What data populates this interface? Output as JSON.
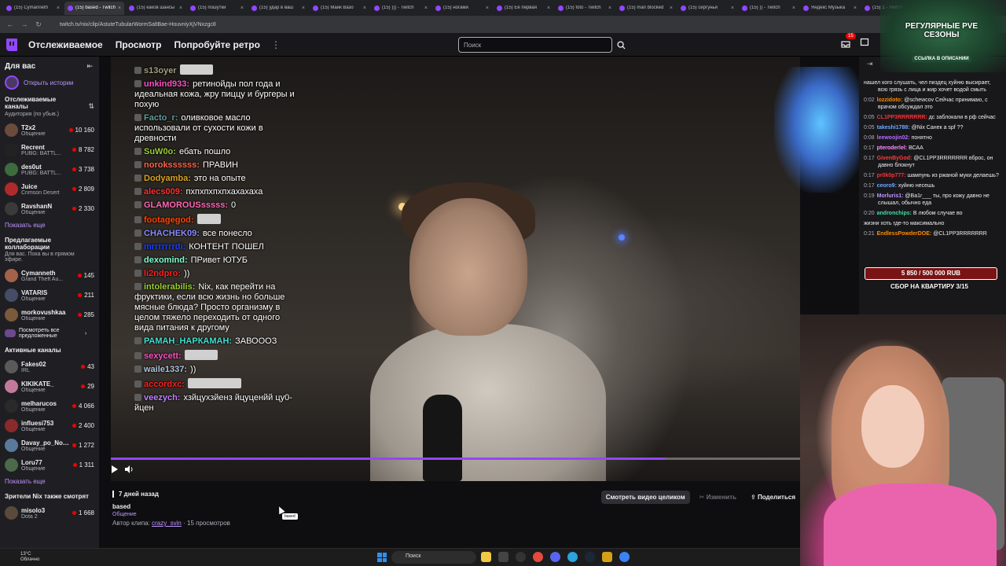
{
  "browser": {
    "tabs": [
      {
        "label": "(15) Cymanneth",
        "active": false
      },
      {
        "label": "(15) based - Twitch",
        "active": true
      },
      {
        "label": "(15) каков шансы",
        "active": false
      },
      {
        "label": "(15) пошутки",
        "active": false
      },
      {
        "label": "(15) удар в ваш",
        "active": false
      },
      {
        "label": "(15) Майк Вазо",
        "active": false
      },
      {
        "label": "(15) ))) - Twitch",
        "active": false
      },
      {
        "label": "(15) ногами",
        "active": false
      },
      {
        "label": "(15) Её первая",
        "active": false
      },
      {
        "label": "(15) foto - Twitch",
        "active": false
      },
      {
        "label": "(15) man blocked",
        "active": false
      },
      {
        "label": "(15) сергунья",
        "active": false
      },
      {
        "label": "(15) )) - Twitch",
        "active": false
      },
      {
        "label": "Яндекс Музыка",
        "active": false
      },
      {
        "label": "(15) 1 - Twitch",
        "active": false
      }
    ],
    "url": "twitch.tv/nix/clip/AstuteTubularWormSaltBae-HouvniyXjVNxzgc8"
  },
  "nav": {
    "following": "Отслеживаемое",
    "browse": "Просмотр",
    "retro": "Попробуйте ретро",
    "more": "⋮",
    "search_placeholder": "Поиск",
    "notif_count": "15"
  },
  "sidebar": {
    "for_you": "Для вас",
    "open_stories": "Открыть истории",
    "followed_title": "Отслеживаемые каналы",
    "followed_sub": "Аудитория (по убыв.)",
    "followed": [
      {
        "name": "T2x2",
        "category": "Общение",
        "viewers": "10 160",
        "color": "#6b4b3b"
      },
      {
        "name": "Recrent",
        "category": "PUBG: BATTL...",
        "viewers": "8 782",
        "color": "#222222"
      },
      {
        "name": "des0ut",
        "category": "PUBG: BATTL...",
        "viewers": "3 738",
        "color": "#3d6b3d"
      },
      {
        "name": "Juice",
        "category": "Crimson Desert",
        "viewers": "2 809",
        "color": "#b02a2a"
      },
      {
        "name": "RavshanN",
        "category": "Общение",
        "viewers": "2 330",
        "color": "#3a3a3a"
      }
    ],
    "show_more_1": "Показать еще",
    "recommended_title": "Предлагаемые коллаборации",
    "recommended_sub": "Для вас. Пока вы в прямом эфире.",
    "recommended": [
      {
        "name": "Cymanneth",
        "category": "Grand Theft Au...",
        "viewers": "145",
        "color": "#a3624a"
      },
      {
        "name": "VATARIS",
        "category": "Общение",
        "viewers": "211",
        "color": "#444c66"
      },
      {
        "name": "morkovushkaa",
        "category": "Общение",
        "viewers": "285",
        "color": "#7a5a3a"
      }
    ],
    "see_all": "Посмотреть все предложенные",
    "active_title": "Активные каналы",
    "active": [
      {
        "name": "Fakes02",
        "category": "IRL",
        "viewers": "43",
        "color": "#5a5a5a"
      },
      {
        "name": "KIKIKATE_",
        "category": "Общение",
        "viewers": "29",
        "color": "#c27a9a"
      },
      {
        "name": "melharucos",
        "category": "Общение",
        "viewers": "4 066",
        "color": "#2a2a2a"
      },
      {
        "name": "influesi753",
        "category": "Общение",
        "viewers": "2 400",
        "color": "#8a2a2a"
      },
      {
        "name": "Davay_po_Nov...",
        "category": "Общение",
        "viewers": "1 272",
        "color": "#5a7a9a"
      },
      {
        "name": "Loru77",
        "category": "Общение",
        "viewers": "1 311",
        "color": "#4a6a4a"
      }
    ],
    "show_more_2": "Показать еще",
    "viewers_also_title": "Зрители Nix также смотрят",
    "viewers_also": [
      {
        "name": "misolo3",
        "category": "Dota 2",
        "viewers": "1 668",
        "color": "#5a4a3a"
      }
    ]
  },
  "video_chat": [
    {
      "user": "s13oyer",
      "color": "#a0a080",
      "text": "",
      "emote": 42
    },
    {
      "user": "unkind933:",
      "color": "#ff4fc8",
      "text": "ретинойды пол года и идеальная кожа, жру пиццу и бургеры и похую",
      "emote": 0
    },
    {
      "user": "Facto_r:",
      "color": "#5f9ea0",
      "text": "оливковое масло использовали от сухости кожи в древности",
      "emote": 0
    },
    {
      "user": "SuW0o:",
      "color": "#9acd32",
      "text": "ебать пошло",
      "emote": 0
    },
    {
      "user": "norokssssss:",
      "color": "#ff6347",
      "text": "ПРАВИН",
      "emote": 0
    },
    {
      "user": "Dodyamba:",
      "color": "#daa520",
      "text": "это на опыте",
      "emote": 0
    },
    {
      "user": "alecs009:",
      "color": "#ff3030",
      "text": "пхпхпхпхпхахахаха",
      "emote": 0
    },
    {
      "user": "GLAMOROUSsssss:",
      "color": "#ff69b4",
      "text": "0",
      "emote": 0
    },
    {
      "user": "footagegod:",
      "color": "#ff4500",
      "text": "",
      "emote": 30
    },
    {
      "user": "CHACHEK09:",
      "color": "#8a8aff",
      "text": "все понесло",
      "emote": 0
    },
    {
      "user": "mrrrrrrrdi:",
      "color": "#1e40ff",
      "text": "КОНТЕНТ ПОШЕЛ",
      "emote": 0
    },
    {
      "user": "dexomind:",
      "color": "#7fffd4",
      "text": "ПРивет ЮТУБ",
      "emote": 0
    },
    {
      "user": "li2ndpro:",
      "color": "#ff2020",
      "text": "))",
      "emote": 0
    },
    {
      "user": "intolerabilis:",
      "color": "#9acd32",
      "text": "Nix, как перейти на фруктики, если всю жизнь но больше мясные блюда? Просто организму в целом тяжело переходить от одного вида питания к другому",
      "emote": 0
    },
    {
      "user": "РАМАН_НАРКАМАН:",
      "color": "#40e0d0",
      "text": "ЗАВОООЗ",
      "emote": 0
    },
    {
      "user": "sexycett:",
      "color": "#ff4fc8",
      "text": "",
      "emote": 42
    },
    {
      "user": "waile1337:",
      "color": "#b0c4de",
      "text": "))",
      "emote": 0
    },
    {
      "user": "accordxc:",
      "color": "#ff2020",
      "text": "",
      "emote": 68
    },
    {
      "user": "veezych:",
      "color": "#c080ff",
      "text": "хзйцухзйенз йцуценйй цу0-йцен",
      "emote": 0
    }
  ],
  "clip": {
    "age": "7 дней назад",
    "title": "based",
    "category": "Общение",
    "author_prefix": "Автор клипа:",
    "author": "crazy_svin",
    "views": "· 15 просмотров",
    "watch_full": "Смотреть видео целиком",
    "edit": "Изменить",
    "share": "Поделиться",
    "tooltip": "based",
    "progress": 0.805
  },
  "right_chat": [
    {
      "time": "",
      "user": "",
      "color": "#efeff1",
      "text": "нашел кого слушать, чел пиздец хуйню высирает, всю грязь с лица и жир хочет водой смыть"
    },
    {
      "time": "0:02",
      "user": "lozzidoto:",
      "color": "#ff8c00",
      "text": "@schewcov Сейчас принимаю, с врачом обсуждал это"
    },
    {
      "time": "0:05",
      "user": "CL1PP3RRRRRRR:",
      "color": "#ff3030",
      "text": "дс заблокали в рф сейчас"
    },
    {
      "time": "0:05",
      "user": "takeshi1788:",
      "color": "#6fa8ff",
      "text": "@Nix Санек а spf ??"
    },
    {
      "time": "0:08",
      "user": "leewoojin02:",
      "color": "#b36bff",
      "text": "понятно"
    },
    {
      "time": "0:17",
      "user": "pteroderlel:",
      "color": "#ff8cff",
      "text": "ВСАА"
    },
    {
      "time": "0:17",
      "user": "GivenByGod:",
      "color": "#ff3b3b",
      "text": "@CL1PP3RRRRRRR вброс, он давно блокнут"
    },
    {
      "time": "0:17",
      "user": "pr0k0p777:",
      "color": "#ff3030",
      "text": "шампунь из ржаной муки делаешь?"
    },
    {
      "time": "0:17",
      "user": "ceoro9:",
      "color": "#6fa8ff",
      "text": "хуйню несешь"
    },
    {
      "time": "0:19",
      "user": "Morluris1:",
      "color": "#bf94ff",
      "text": "@Ba1r___ ты, про кожу давно не слышал, обычно еда"
    },
    {
      "time": "0:20",
      "user": "andronchips:",
      "color": "#40e0a0",
      "text": "В любом случае во"
    },
    {
      "time": "",
      "user": "",
      "color": "#efeff1",
      "text": "жизни хоть где-то максимально"
    },
    {
      "time": "0:21",
      "user": "EndlessPowderDOE:",
      "color": "#ff8c00",
      "text": "@CL1PP3RRRRRRR"
    }
  ],
  "goal": {
    "amount": "5 850 / 500 000 RUB",
    "label": "СБОР НА КВАРТИРУ 3/15"
  },
  "banner": {
    "title": "РЕГУЛЯРНЫЕ PVE СЕЗОНЫ",
    "link": "ССЫЛКА В ОПИСАНИИ"
  },
  "taskbar": {
    "temp": "13°C",
    "weather": "Облачно",
    "search": "Поиск"
  }
}
